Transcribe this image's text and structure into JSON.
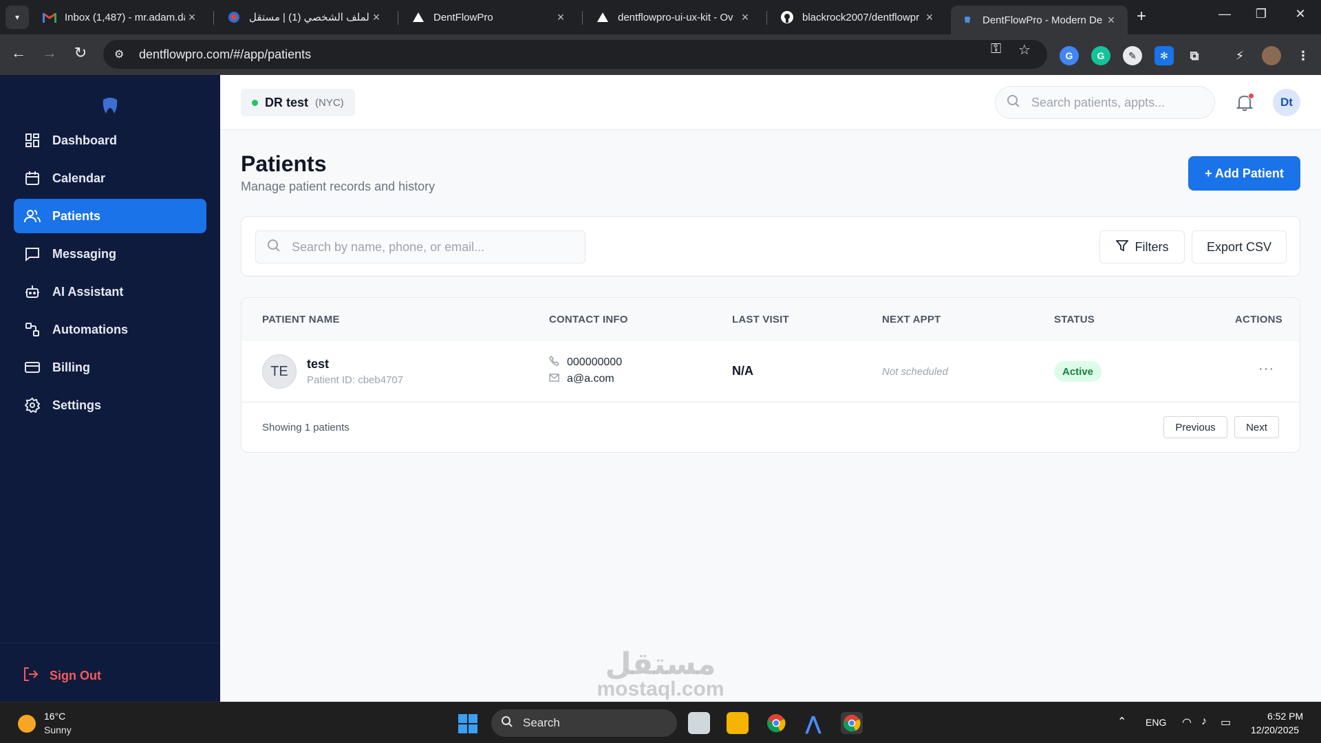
{
  "browser": {
    "tabs": [
      {
        "title": "Inbox (1,487) - mr.adam.da",
        "icon": "gmail-icon"
      },
      {
        "title": "الملف الشخصي (1) | مستقل",
        "icon": "mostaql-icon"
      },
      {
        "title": "DentFlowPro",
        "icon": "vercel-icon"
      },
      {
        "title": "dentflowpro-ui-ux-kit - Ov",
        "icon": "vercel-icon"
      },
      {
        "title": "blackrock2007/dentflowpr",
        "icon": "github-icon"
      },
      {
        "title": "DentFlowPro - Modern De",
        "icon": "app-favicon"
      }
    ],
    "url": "dentflowpro.com/#/app/patients"
  },
  "sidebar": {
    "items": [
      {
        "label": "Dashboard",
        "icon": "grid-icon"
      },
      {
        "label": "Calendar",
        "icon": "calendar-icon"
      },
      {
        "label": "Patients",
        "icon": "users-icon",
        "active": true
      },
      {
        "label": "Messaging",
        "icon": "message-icon"
      },
      {
        "label": "AI Assistant",
        "icon": "robot-icon"
      },
      {
        "label": "Automations",
        "icon": "workflow-icon"
      },
      {
        "label": "Billing",
        "icon": "credit-card-icon"
      },
      {
        "label": "Settings",
        "icon": "gear-icon"
      }
    ],
    "sign_out": "Sign Out"
  },
  "header": {
    "clinic_name": "DR test",
    "clinic_location": "(NYC)",
    "search_placeholder": "Search patients, appts...",
    "user_initials": "Dt"
  },
  "page": {
    "title": "Patients",
    "subtitle": "Manage patient records and history",
    "add_button": "+ Add Patient"
  },
  "filters": {
    "search_placeholder": "Search by name, phone, or email...",
    "filters_label": "Filters",
    "export_label": "Export CSV"
  },
  "table": {
    "columns": [
      "PATIENT NAME",
      "CONTACT INFO",
      "LAST VISIT",
      "NEXT APPT",
      "STATUS",
      "ACTIONS"
    ],
    "rows": [
      {
        "initials": "TE",
        "name": "test",
        "patient_id": "Patient ID: cbeb4707",
        "phone": "000000000",
        "email": "a@a.com",
        "last_visit": "N/A",
        "next_appt": "Not scheduled",
        "status": "Active",
        "actions": "···"
      }
    ],
    "footer": "Showing 1 patients",
    "prev_label": "Previous",
    "next_label": "Next"
  },
  "watermark": {
    "text": "مستقل",
    "sub": "mostaql.com"
  },
  "taskbar": {
    "temperature": "16°C",
    "condition": "Sunny",
    "search_label": "Search",
    "language": "ENG",
    "time": "6:52 PM",
    "date": "12/20/2025"
  },
  "colors": {
    "sidebar_bg": "#0f1b3d",
    "accent": "#1a73e8",
    "status_active_bg": "#dcfce7",
    "status_active_text": "#15803d",
    "sign_out": "#f45b5b"
  }
}
